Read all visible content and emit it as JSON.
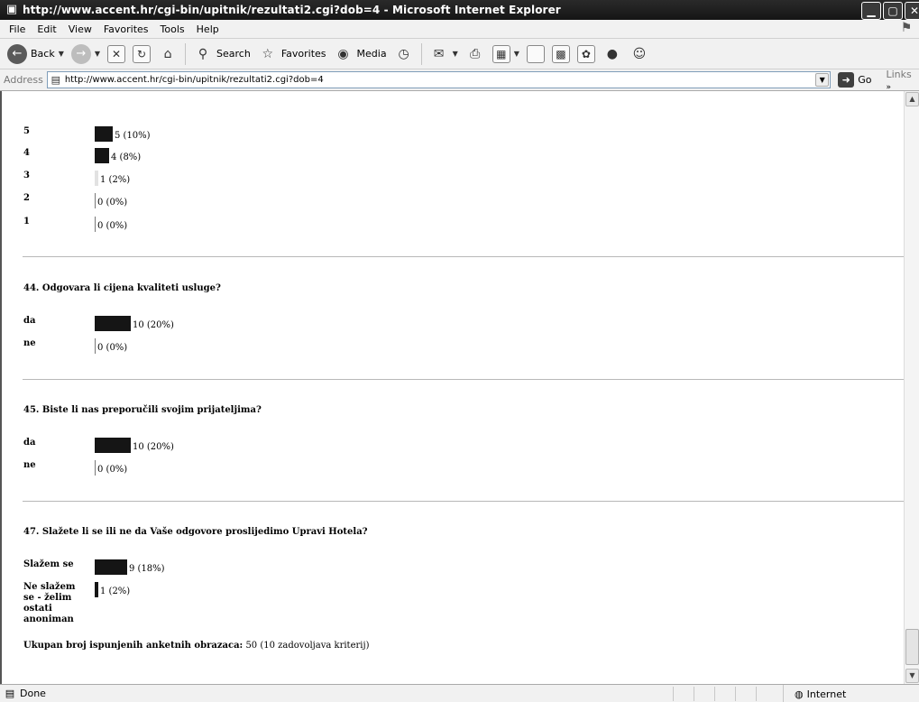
{
  "window": {
    "title": "http://www.accent.hr/cgi-bin/upitnik/rezultati2.cgi?dob=4 - Microsoft Internet Explorer",
    "controls": [
      "minimize",
      "maximize",
      "close"
    ]
  },
  "menubar": {
    "items": [
      "File",
      "Edit",
      "View",
      "Favorites",
      "Tools",
      "Help"
    ]
  },
  "toolbar": {
    "back_label": "Back",
    "search_label": "Search",
    "favorites_label": "Favorites",
    "media_label": "Media"
  },
  "addressbar": {
    "label": "Address",
    "url": "http://www.accent.hr/cgi-bin/upitnik/rezultati2.cgi?dob=4",
    "go_label": "Go",
    "links_label": "Links"
  },
  "content": {
    "prev_question": {
      "rows": [
        {
          "label": "5",
          "value_text": "5 (10%)",
          "percent": 10
        },
        {
          "label": "4",
          "value_text": "4 (8%)",
          "percent": 8
        },
        {
          "label": "3",
          "value_text": "1 (2%)",
          "percent": 2
        },
        {
          "label": "2",
          "value_text": "0 (0%)",
          "percent": 0
        },
        {
          "label": "1",
          "value_text": "0 (0%)",
          "percent": 0
        }
      ]
    },
    "q44": {
      "title": "44. Odgovara li cijena kvaliteti usluge?",
      "rows": [
        {
          "label": "da",
          "value_text": "10 (20%)",
          "percent": 20
        },
        {
          "label": "ne",
          "value_text": "0 (0%)",
          "percent": 0
        }
      ]
    },
    "q45": {
      "title": "45. Biste li nas preporučili svojim prijateljima?",
      "rows": [
        {
          "label": "da",
          "value_text": "10 (20%)",
          "percent": 20
        },
        {
          "label": "ne",
          "value_text": "0 (0%)",
          "percent": 0
        }
      ]
    },
    "q47": {
      "title": "47. Slažete li se ili ne da Vaše odgovore proslijedimo Upravi Hotela?",
      "rows": [
        {
          "label": "Slažem se",
          "value_text": "9 (18%)",
          "percent": 18
        },
        {
          "label": "Ne slažem se - želim ostati anoniman",
          "value_text": "1 (2%)",
          "percent": 2
        }
      ]
    },
    "total": {
      "label": "Ukupan broj ispunjenih anketnih obrazaca:",
      "value": "50 (10 zadovoljava kriterij)"
    }
  },
  "statusbar": {
    "status_text": "Done",
    "zone_text": "Internet"
  }
}
